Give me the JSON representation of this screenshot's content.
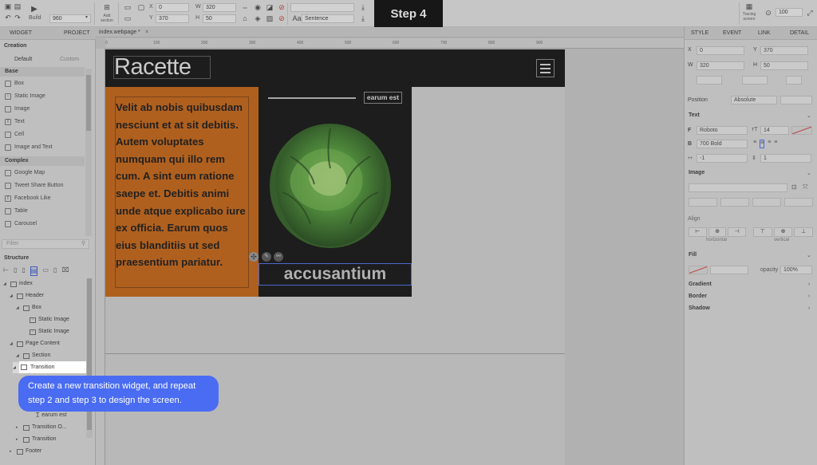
{
  "step_banner": "Step 4",
  "toolbar": {
    "build_label": "Build",
    "canvas_width": "960",
    "add_section_label": "Add section",
    "x_label": "X",
    "x_value": "0",
    "y_label": "Y",
    "y_value": "370",
    "w_label": "W",
    "w_value": "320",
    "h_label": "H",
    "h_value": "50",
    "text_transform_value": "Sentence",
    "tracing_label": "Tracing screen",
    "zoom_value": "100"
  },
  "left_panel": {
    "tabs": [
      "WIDGET",
      "PROJECT"
    ],
    "creation_title": "Creation",
    "subtabs": [
      "Default",
      "Custom"
    ],
    "base_heading": "Base",
    "base_items": [
      "Box",
      "Static Image",
      "Image",
      "Text",
      "Cell",
      "Image and Text"
    ],
    "complex_heading": "Complex",
    "complex_items": [
      "Google Map",
      "Tweet Share Button",
      "Facebook Like",
      "Table",
      "Carousel"
    ],
    "filter_placeholder": "Filter",
    "structure_title": "Structure",
    "tree": [
      "index",
      "Header",
      "Box",
      "Static Image",
      "Static Image",
      "Page Content",
      "Section",
      "Transition",
      "earum est",
      "Transition O...",
      "Transition",
      "Footer"
    ]
  },
  "document_tab": "index.webpage *",
  "canvas": {
    "logo_text": "Racette",
    "body_text": "Velit ab nobis quibusdam nesciunt et at sit debitis. Autem voluptates numquam qui illo rem cum. A sint eum ratione saepe et. Debitis animi unde atque explicabo iure ex officia. Earum quos eius blanditiis ut sed praesentium pariatur.",
    "tag_text": "earum est",
    "caption_text": "accusantium",
    "ruler_ticks": [
      "0",
      "100",
      "200",
      "300",
      "400",
      "500",
      "600",
      "700",
      "800",
      "900"
    ]
  },
  "tooltip": {
    "text": "Create a new transition widget, and repeat step 2 and step 3 to design the screen."
  },
  "right_panel": {
    "tabs": [
      "STYLE",
      "EVENT",
      "LINK",
      "DETAIL"
    ],
    "x_label": "X",
    "x_value": "0",
    "y_label": "Y",
    "y_value": "370",
    "w_label": "W",
    "w_value": "320",
    "h_label": "H",
    "h_value": "50",
    "position_label": "Position",
    "position_value": "Absolute",
    "text_heading": "Text",
    "font_value": "Roboto",
    "font_size_value": "14",
    "weight_value": "700 Bold",
    "letter_spacing_value": "-1",
    "line_height_value": "1",
    "image_heading": "Image",
    "align_heading": "Align",
    "horizontal_label": "horizontal",
    "vertical_label": "vertical",
    "fill_heading": "Fill",
    "opacity_label": "opacity",
    "opacity_value": "100%",
    "gradient_heading": "Gradient",
    "border_heading": "Border",
    "shadow_heading": "Shadow"
  },
  "colors": {
    "accent": "#4a6cf2",
    "orange": "#c8620e",
    "dark": "#0c0c0c"
  }
}
